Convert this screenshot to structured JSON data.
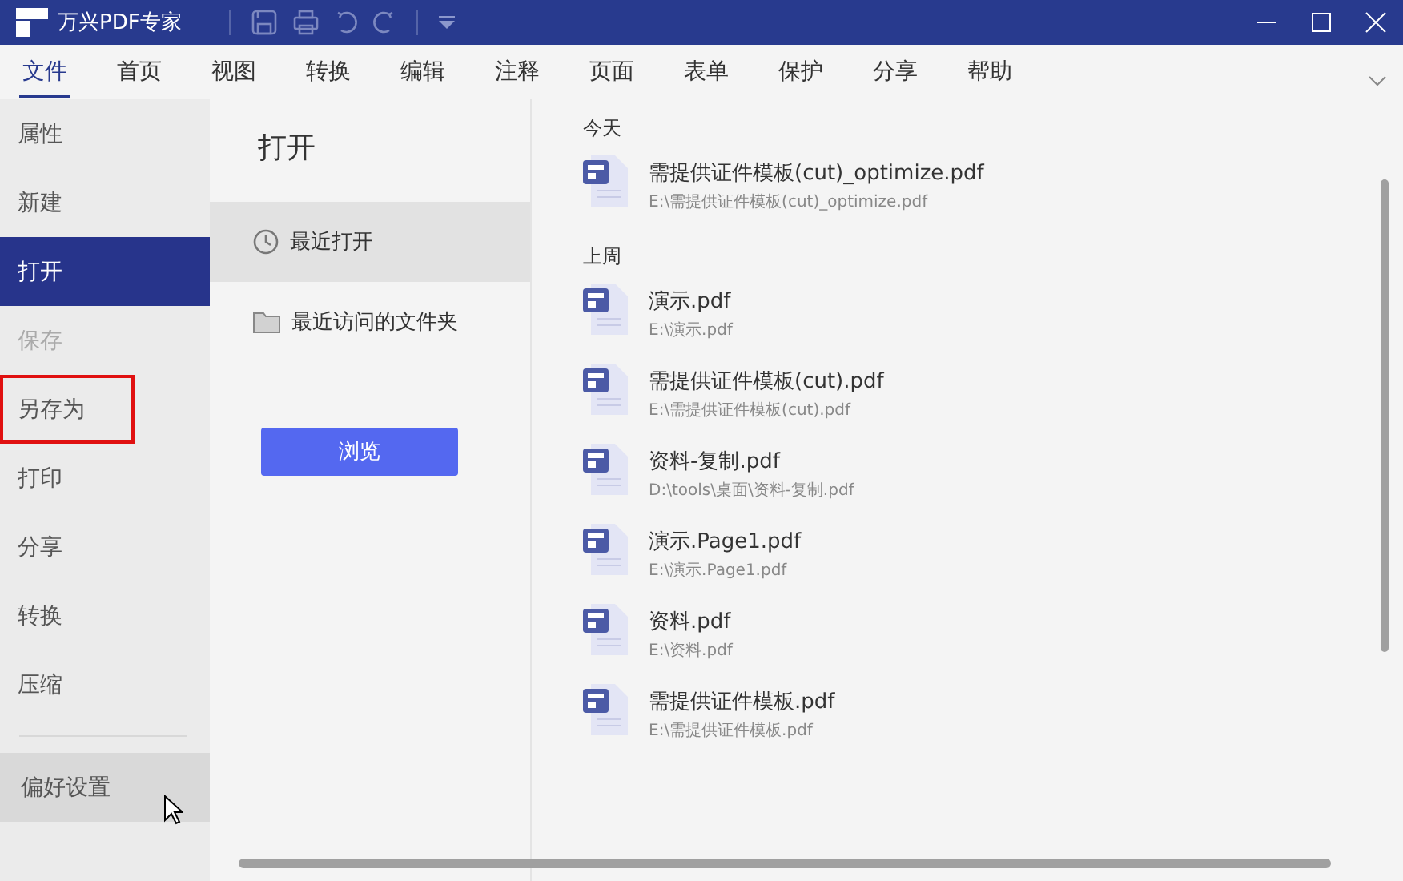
{
  "window": {
    "title": "万兴PDF专家"
  },
  "menu": [
    {
      "label": "文件",
      "selected": true
    },
    {
      "label": "首页",
      "selected": false
    },
    {
      "label": "视图",
      "selected": false
    },
    {
      "label": "转换",
      "selected": false
    },
    {
      "label": "编辑",
      "selected": false
    },
    {
      "label": "注释",
      "selected": false
    },
    {
      "label": "页面",
      "selected": false
    },
    {
      "label": "表单",
      "selected": false
    },
    {
      "label": "保护",
      "selected": false
    },
    {
      "label": "分享",
      "selected": false
    },
    {
      "label": "帮助",
      "selected": false
    }
  ],
  "sidebar": {
    "items": [
      {
        "label": "属性",
        "selected": false,
        "disabled": false,
        "highlighted": false
      },
      {
        "label": "新建",
        "selected": false,
        "disabled": false,
        "highlighted": false
      },
      {
        "label": "打开",
        "selected": true,
        "disabled": false,
        "highlighted": false
      },
      {
        "label": "保存",
        "selected": false,
        "disabled": true,
        "highlighted": false
      },
      {
        "label": "另存为",
        "selected": false,
        "disabled": false,
        "highlighted": true
      },
      {
        "label": "打印",
        "selected": false,
        "disabled": false,
        "highlighted": false
      },
      {
        "label": "分享",
        "selected": false,
        "disabled": false,
        "highlighted": false
      },
      {
        "label": "转换",
        "selected": false,
        "disabled": false,
        "highlighted": false
      },
      {
        "label": "压缩",
        "selected": false,
        "disabled": false,
        "highlighted": false
      }
    ],
    "footer": {
      "label": "偏好设置",
      "hovered": true
    }
  },
  "open_panel": {
    "title": "打开",
    "sources": [
      {
        "label": "最近打开",
        "kind": "clock",
        "selected": true
      },
      {
        "label": "最近访问的文件夹",
        "kind": "folder",
        "selected": false
      }
    ],
    "browse_button": "浏览"
  },
  "recent": [
    {
      "heading": "今天",
      "files": [
        {
          "name": "需提供证件模板(cut)_optimize.pdf",
          "path": "E:\\需提供证件模板(cut)_optimize.pdf"
        }
      ]
    },
    {
      "heading": "上周",
      "files": [
        {
          "name": "演示.pdf",
          "path": "E:\\演示.pdf"
        },
        {
          "name": "需提供证件模板(cut).pdf",
          "path": "E:\\需提供证件模板(cut).pdf"
        },
        {
          "name": "资料-复制.pdf",
          "path": "D:\\tools\\桌面\\资料-复制.pdf"
        },
        {
          "name": "演示.Page1.pdf",
          "path": "E:\\演示.Page1.pdf"
        },
        {
          "name": "资料.pdf",
          "path": "E:\\资料.pdf"
        },
        {
          "name": "需提供证件模板.pdf",
          "path": "E:\\需提供证件模板.pdf"
        }
      ]
    }
  ]
}
